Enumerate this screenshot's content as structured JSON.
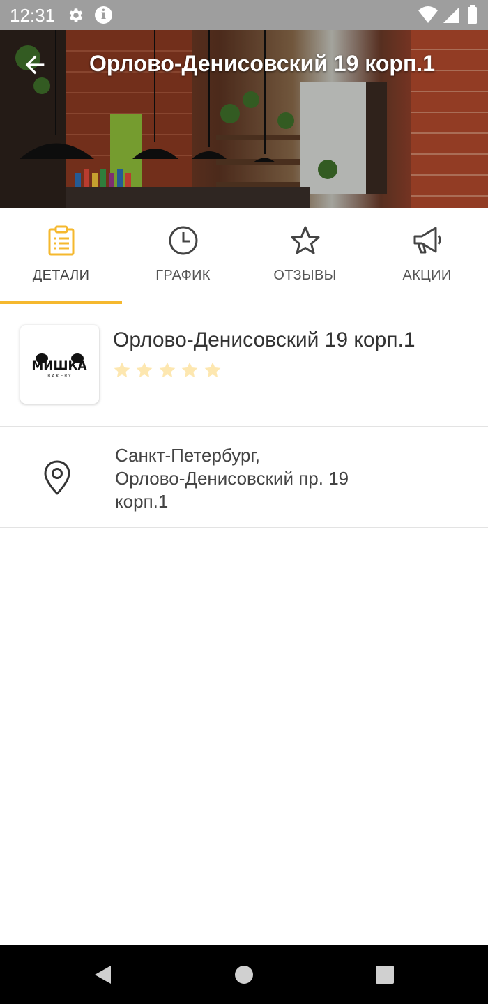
{
  "status_bar": {
    "time": "12:31",
    "icons": [
      "gear-icon",
      "info-icon",
      "wifi-icon",
      "signal-icon",
      "battery-icon"
    ]
  },
  "header": {
    "title": "Орлово-Денисовский 19 корп.1",
    "back_icon": "arrow-left-icon"
  },
  "tabs": [
    {
      "label": "ДЕТАЛИ",
      "icon": "clipboard-icon",
      "active": true
    },
    {
      "label": "ГРАФИК",
      "icon": "clock-icon",
      "active": false
    },
    {
      "label": "ОТЗЫВЫ",
      "icon": "star-icon",
      "active": false
    },
    {
      "label": "АКЦИИ",
      "icon": "megaphone-icon",
      "active": false
    }
  ],
  "shop": {
    "name": "Орлово-Денисовский 19 корп.1",
    "logo_text": "МИШКА",
    "logo_subtext": "BAKERY",
    "rating": 5,
    "rating_max": 5,
    "star_color": "#fde7b0"
  },
  "address": {
    "line1": "Санкт-Петербург,",
    "line2": "Орлово-Денисовский пр. 19",
    "line3": "корп.1"
  },
  "colors": {
    "accent": "#f5b82e",
    "status_bar": "#9e9e9e",
    "nav_bar": "#000000"
  }
}
